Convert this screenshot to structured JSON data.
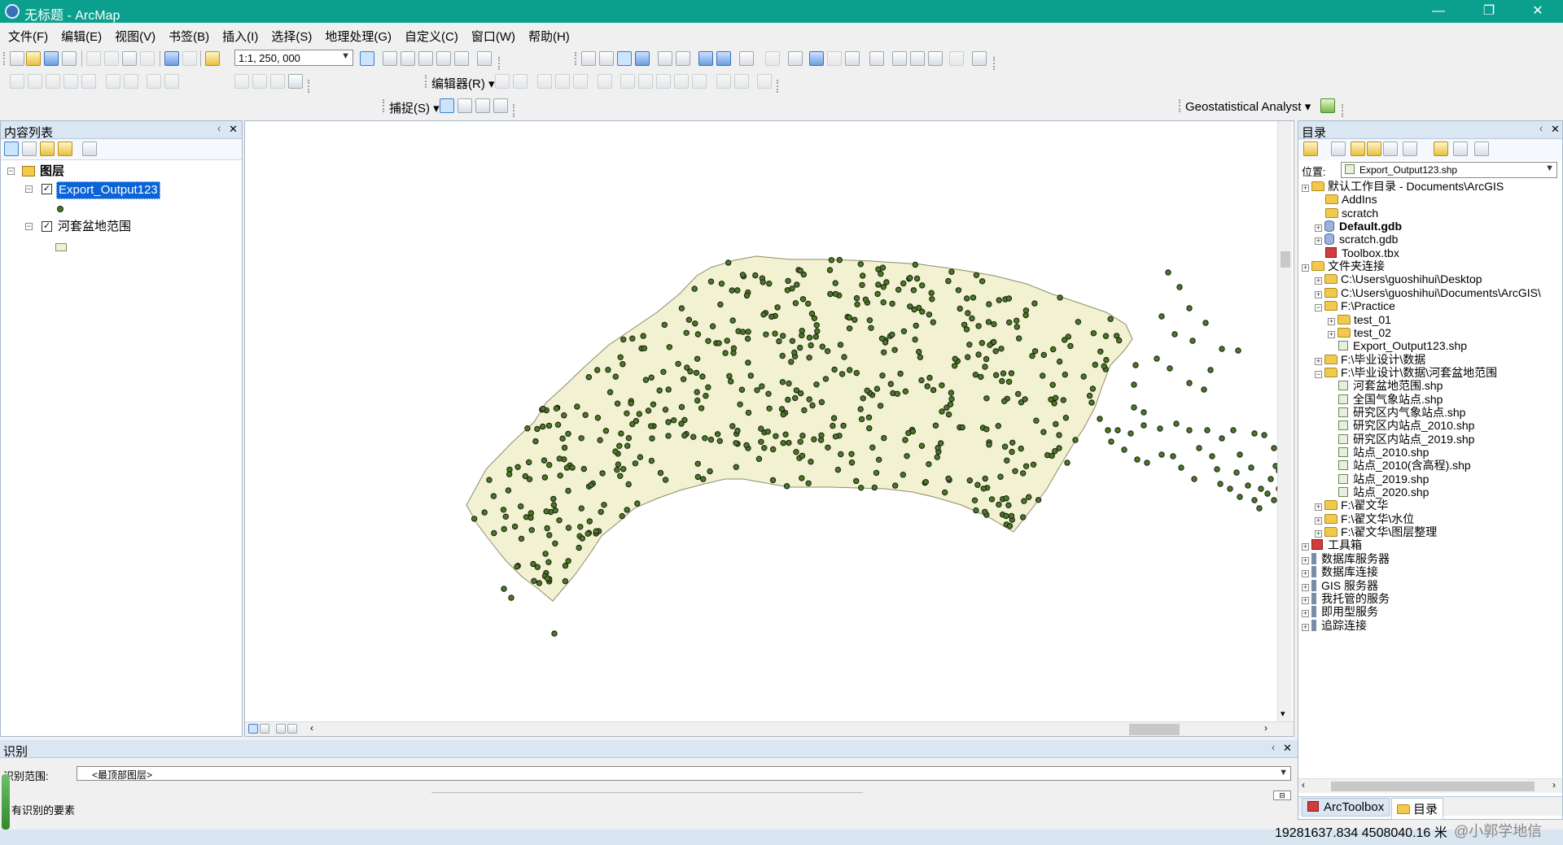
{
  "window": {
    "title": "无标题 - ArcMap",
    "minimize": "—",
    "restore": "❐",
    "close": "✕"
  },
  "menu": [
    "文件(F)",
    "编辑(E)",
    "视图(V)",
    "书签(B)",
    "插入(I)",
    "选择(S)",
    "地理处理(G)",
    "自定义(C)",
    "窗口(W)",
    "帮助(H)"
  ],
  "toolbar": {
    "scale": "1:1, 250, 000",
    "editor_label": "编辑器(R)",
    "snapping_label": "捕捉(S)",
    "geostat_label": "Geostatistical Analyst"
  },
  "toc": {
    "title": "内容列表",
    "pin": "ᚲ",
    "close": "✕",
    "root": "图层",
    "layers": [
      {
        "name": "Export_Output123",
        "checked": true,
        "selected": true
      },
      {
        "name": "河套盆地范围",
        "checked": true,
        "selected": false
      }
    ]
  },
  "catalog": {
    "title": "目录",
    "location_label": "位置:",
    "location_value": "Export_Output123.shp",
    "items": [
      {
        "label": "默认工作目录 - Documents\\ArcGIS",
        "icon": "folder-home-icon",
        "level": 0,
        "bold": false
      },
      {
        "label": "AddIns",
        "icon": "folder-icon",
        "level": 1,
        "bold": false
      },
      {
        "label": "scratch",
        "icon": "folder-icon",
        "level": 1,
        "bold": false
      },
      {
        "label": "Default.gdb",
        "icon": "geodatabase-icon",
        "level": 1,
        "bold": true
      },
      {
        "label": "scratch.gdb",
        "icon": "geodatabase-icon",
        "level": 1,
        "bold": false
      },
      {
        "label": "Toolbox.tbx",
        "icon": "toolbox-icon",
        "level": 1,
        "bold": false
      },
      {
        "label": "文件夹连接",
        "icon": "folder-connections-icon",
        "level": 0,
        "bold": false
      },
      {
        "label": "C:\\Users\\guoshihui\\Desktop",
        "icon": "folder-icon",
        "level": 1,
        "bold": false
      },
      {
        "label": "C:\\Users\\guoshihui\\Documents\\ArcGIS\\",
        "icon": "folder-icon",
        "level": 1,
        "bold": false
      },
      {
        "label": "F:\\Practice",
        "icon": "folder-icon",
        "level": 1,
        "bold": false
      },
      {
        "label": "test_01",
        "icon": "folder-icon",
        "level": 2,
        "bold": false
      },
      {
        "label": "test_02",
        "icon": "folder-icon",
        "level": 2,
        "bold": false
      },
      {
        "label": "Export_Output123.shp",
        "icon": "shapefile-icon",
        "level": 2,
        "bold": false
      },
      {
        "label": "F:\\毕业设计\\数据",
        "icon": "folder-icon",
        "level": 1,
        "bold": false
      },
      {
        "label": "F:\\毕业设计\\数据\\河套盆地范围",
        "icon": "folder-icon",
        "level": 1,
        "bold": false
      },
      {
        "label": "河套盆地范围.shp",
        "icon": "shapefile-icon",
        "level": 2,
        "bold": false
      },
      {
        "label": "全国气象站点.shp",
        "icon": "shapefile-icon",
        "level": 2,
        "bold": false
      },
      {
        "label": "研究区内气象站点.shp",
        "icon": "shapefile-icon",
        "level": 2,
        "bold": false
      },
      {
        "label": "研究区内站点_2010.shp",
        "icon": "shapefile-icon",
        "level": 2,
        "bold": false
      },
      {
        "label": "研究区内站点_2019.shp",
        "icon": "shapefile-icon",
        "level": 2,
        "bold": false
      },
      {
        "label": "站点_2010.shp",
        "icon": "shapefile-icon",
        "level": 2,
        "bold": false
      },
      {
        "label": "站点_2010(含高程).shp",
        "icon": "shapefile-icon",
        "level": 2,
        "bold": false
      },
      {
        "label": "站点_2019.shp",
        "icon": "shapefile-icon",
        "level": 2,
        "bold": false
      },
      {
        "label": "站点_2020.shp",
        "icon": "shapefile-icon",
        "level": 2,
        "bold": false
      },
      {
        "label": "F:\\翟文华",
        "icon": "folder-icon",
        "level": 1,
        "bold": false
      },
      {
        "label": "F:\\翟文华\\水位",
        "icon": "folder-icon",
        "level": 1,
        "bold": false
      },
      {
        "label": "F:\\翟文华\\图层整理",
        "icon": "folder-icon",
        "level": 1,
        "bold": false
      },
      {
        "label": "工具箱",
        "icon": "toolbox-icon",
        "level": 0,
        "bold": false
      },
      {
        "label": "数据库服务器",
        "icon": "server-icon",
        "level": 0,
        "bold": false
      },
      {
        "label": "数据库连接",
        "icon": "server-icon",
        "level": 0,
        "bold": false
      },
      {
        "label": "GIS 服务器",
        "icon": "server-icon",
        "level": 0,
        "bold": false
      },
      {
        "label": "我托管的服务",
        "icon": "server-icon",
        "level": 0,
        "bold": false
      },
      {
        "label": "即用型服务",
        "icon": "server-icon",
        "level": 0,
        "bold": false
      },
      {
        "label": "追踪连接",
        "icon": "server-icon",
        "level": 0,
        "bold": false
      }
    ],
    "tabs": [
      "ArcToolbox",
      "目录"
    ]
  },
  "identify": {
    "title": "识别",
    "range_label": "识别范围:",
    "range_value": "<最顶部图层>",
    "result_text": "有识别的要素"
  },
  "status": {
    "coordinates": "19281637.834  4508040.16 米",
    "watermark": "@小郭学地信"
  },
  "colors": {
    "titlebar": "#0aa08d",
    "polygon_fill": "#f2f2d2",
    "polygon_stroke": "#8c8c6a",
    "point_fill": "#4a7a1e",
    "point_stroke": "#1a1a1a",
    "selection": "#0a64d6"
  }
}
